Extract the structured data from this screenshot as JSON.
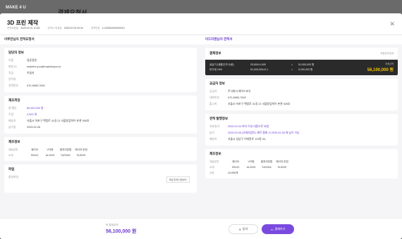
{
  "background": {
    "logo": "MAKE 4 U",
    "title": "결제요청서"
  },
  "modal": {
    "title": "3D 프린 제작",
    "meta": [
      {
        "k": "견적요청일",
        "v": "2025.02.01 10:48"
      },
      {
        "k": "견적서 작성일",
        "v": "2025.02.09 09:32"
      },
      {
        "k": "견적번호",
        "v": "e-202502090000001"
      }
    ],
    "close_icon": "close-icon"
  },
  "left": {
    "header": "이루만님의 견적요청서",
    "contact": {
      "title": "담당자 정보",
      "rows": [
        {
          "k": "이름",
          "v": "정류정원"
        },
        {
          "k": "회원 ID",
          "v": "makefor.you@makeforyou.kr"
        },
        {
          "k": "직급",
          "v": "이끌지"
        },
        {
          "k": "연락처",
          "v": ""
        },
        {
          "k": "전화번호",
          "v": "070-8983-7692"
        }
      ]
    },
    "request": {
      "title": "제조희망",
      "rows": [
        {
          "k": "총 예산",
          "v": "60,000,000 원",
          "p": true
        },
        {
          "k": "수량",
          "v": "2,000 개",
          "p": true
        },
        {
          "k": "배송지",
          "v": "서울시 마포구 백범로 31길 21 서울창업허브 본관 505호"
        },
        {
          "k": "납기일",
          "v": "2025.02.28"
        }
      ]
    },
    "spec": {
      "title": "제조정보",
      "headers": [
        "재질분류",
        "재티어",
        "V자형",
        "열처리방법",
        "레이저 운접"
      ],
      "row_label": "소재",
      "values": [
        "SS410",
        "AL2025",
        "SUS304",
        "SUS20f"
      ]
    },
    "files": {
      "title": "파일",
      "label": "첨부파일",
      "button": "파일 전체 다운로드"
    }
  },
  "right": {
    "header": "이드터랜님의 견적서",
    "pay": {
      "title": "결제정보",
      "note": "최종금액 합계",
      "lines": [
        {
          "k": "공급가 (제품단가*수량)",
          "expr": "25,500×2,000",
          "op": "=",
          "v": "51,000,000 원"
        },
        {
          "k": "부가세 10%",
          "expr": "51,000,000×0.1",
          "op": "=",
          "v": "5,100,000 원"
        }
      ],
      "total_label": "최종금액",
      "total": "56,100,000 원"
    },
    "supplier": {
      "title": "공급자 정보",
      "rows": [
        {
          "k": "공급자",
          "v": "주식회사 메이드포유"
        },
        {
          "k": "대표번호",
          "v": "070-8983-7692"
        },
        {
          "k": "출고지",
          "v": "서울시 마포구 백범로 31길 21 서울창업허브 본관 525호"
        }
      ]
    },
    "delivery": {
      "title": "견적 발행정보",
      "rows": [
        {
          "k": "유효일자",
          "v": "2025.02.04 까지 이내 내용으로 요청",
          "p": true
        },
        {
          "k": "납기",
          "v": "2025.02.06 (유래처검토) 제작 결제 시 2025.02.28 에 납기 가능",
          "p": true
        },
        {
          "k": "배송지",
          "v": "서울시 성남구 이태원로 129동 54,"
        }
      ]
    },
    "spec": {
      "title": "제조정보",
      "headers": [
        "재질분류",
        "재티어",
        "V자형",
        "열처리방법",
        "레이저 운접"
      ],
      "row_label": "소재",
      "values": [
        "SS410",
        "AL2025",
        "SUS304",
        "SUS20f"
      ],
      "qty_label": "수량",
      "qty": "10,000개"
    }
  },
  "footer": {
    "total_label": "총 결제금액",
    "total": "56,100,000 원",
    "close_label": "닫기",
    "pay_label": "결제하기"
  }
}
